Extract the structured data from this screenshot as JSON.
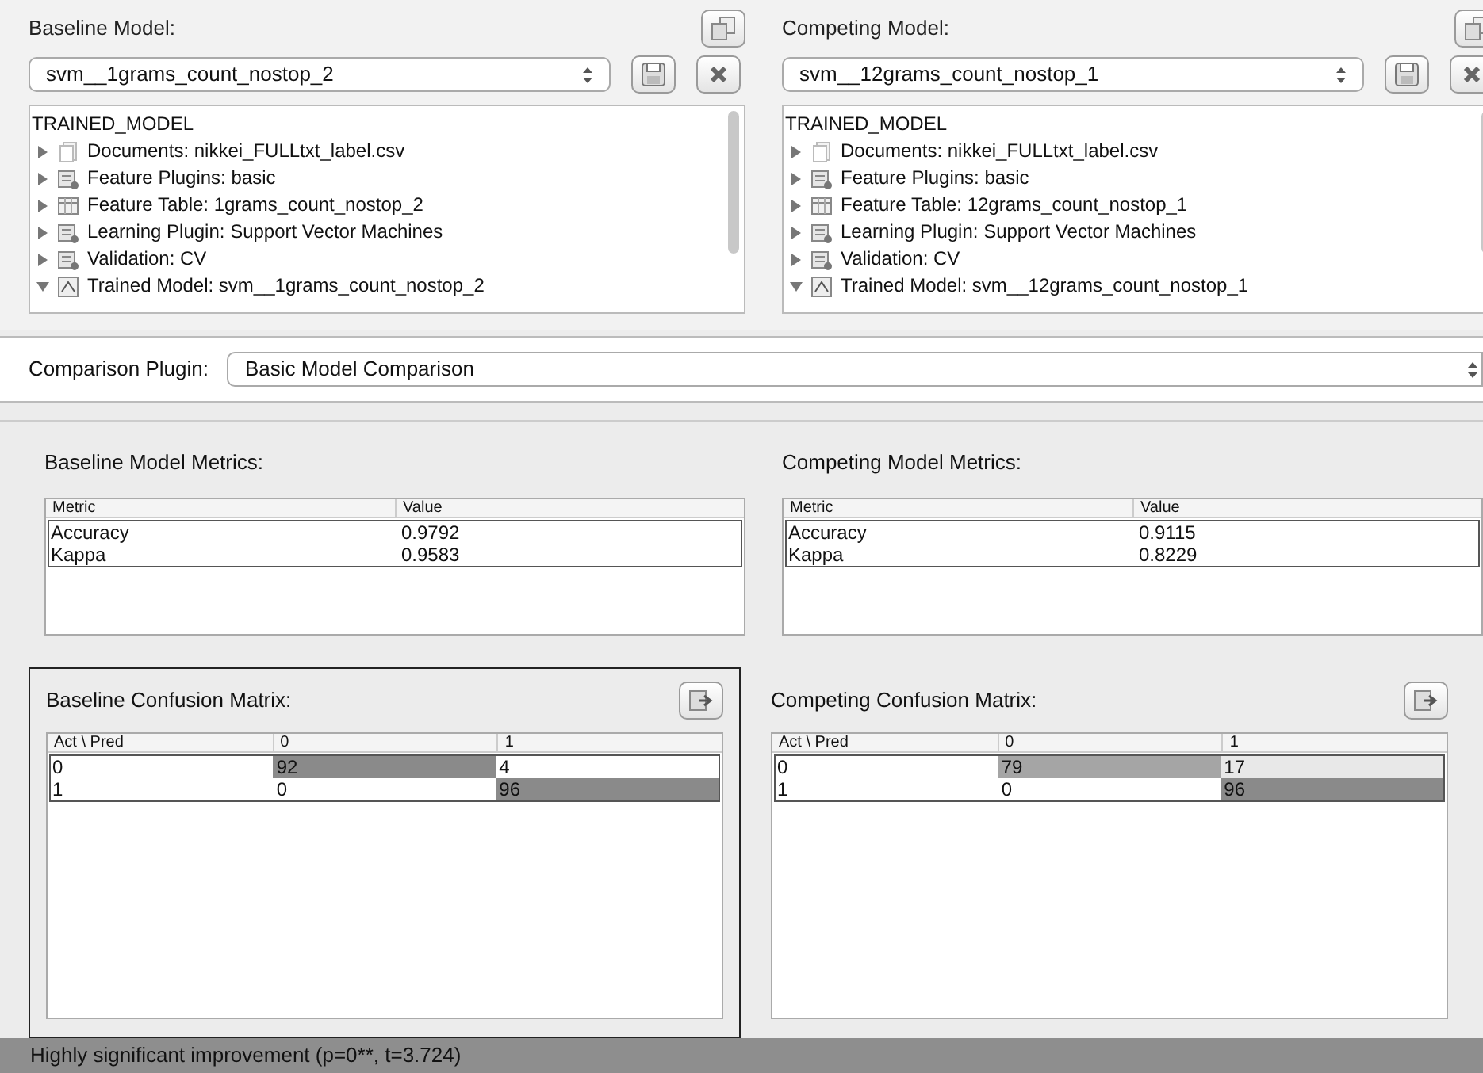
{
  "models": [
    {
      "label": "Baseline Model:",
      "selection": "svm__1grams_count_nostop_2",
      "tree": {
        "root": "TRAINED_MODEL",
        "items": [
          {
            "kind": "docs",
            "text": "Documents: nikkei_FULLtxt_label.csv",
            "expanded": false
          },
          {
            "kind": "plugin",
            "text": "Feature Plugins: basic",
            "expanded": false
          },
          {
            "kind": "table",
            "text": "Feature Table: 1grams_count_nostop_2",
            "expanded": false
          },
          {
            "kind": "plugin",
            "text": "Learning Plugin:  Support Vector Machines",
            "expanded": false
          },
          {
            "kind": "plugin",
            "text": "Validation: CV",
            "expanded": false
          },
          {
            "kind": "model",
            "text": "Trained Model: svm__1grams_count_nostop_2",
            "expanded": true
          }
        ]
      }
    },
    {
      "label": "Competing Model:",
      "selection": "svm__12grams_count_nostop_1",
      "tree": {
        "root": "TRAINED_MODEL",
        "items": [
          {
            "kind": "docs",
            "text": "Documents: nikkei_FULLtxt_label.csv",
            "expanded": false
          },
          {
            "kind": "plugin",
            "text": "Feature Plugins: basic",
            "expanded": false
          },
          {
            "kind": "table",
            "text": "Feature Table: 12grams_count_nostop_1",
            "expanded": false
          },
          {
            "kind": "plugin",
            "text": "Learning Plugin:  Support Vector Machines",
            "expanded": false
          },
          {
            "kind": "plugin",
            "text": "Validation: CV",
            "expanded": false
          },
          {
            "kind": "model",
            "text": "Trained Model: svm__12grams_count_nostop_1",
            "expanded": true
          }
        ]
      }
    }
  ],
  "comparison_plugin": {
    "label": "Comparison Plugin:",
    "selection": "Basic Model Comparison"
  },
  "metrics": [
    {
      "title": "Baseline Model Metrics:",
      "columns": [
        "Metric",
        "Value"
      ],
      "rows": [
        [
          "Accuracy",
          "0.9792"
        ],
        [
          "Kappa",
          "0.9583"
        ]
      ]
    },
    {
      "title": "Competing Model Metrics:",
      "columns": [
        "Metric",
        "Value"
      ],
      "rows": [
        [
          "Accuracy",
          "0.9115"
        ],
        [
          "Kappa",
          "0.8229"
        ]
      ]
    }
  ],
  "confusion": [
    {
      "title": "Baseline Confusion Matrix:",
      "selected": true,
      "columns": [
        "Act \\ Pred",
        "0",
        "1"
      ],
      "rows": [
        [
          {
            "text": "0"
          },
          {
            "text": "92",
            "color": "#8a8a8a"
          },
          {
            "text": "4"
          }
        ],
        [
          {
            "text": "1"
          },
          {
            "text": "0"
          },
          {
            "text": "96",
            "color": "#8a8a8a"
          }
        ]
      ]
    },
    {
      "title": "Competing Confusion Matrix:",
      "selected": false,
      "columns": [
        "Act \\ Pred",
        "0",
        "1"
      ],
      "rows": [
        [
          {
            "text": "0"
          },
          {
            "text": "79",
            "color": "#a5a5a5"
          },
          {
            "text": "17",
            "color": "#e8e8e8"
          }
        ],
        [
          {
            "text": "1"
          },
          {
            "text": "0"
          },
          {
            "text": "96",
            "color": "#8a8a8a"
          }
        ]
      ]
    }
  ],
  "status_bar": "Highly significant improvement (p=0**, t=3.724)"
}
